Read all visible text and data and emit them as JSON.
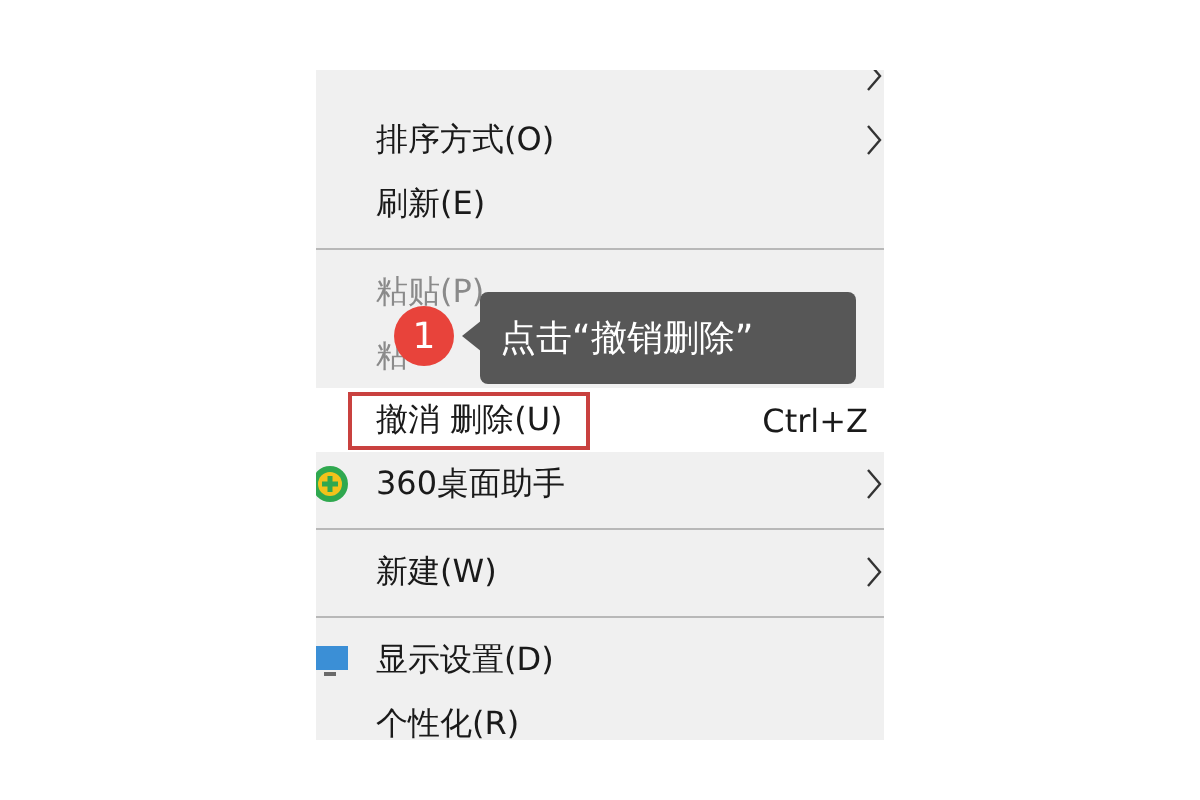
{
  "menu": {
    "items": [
      {
        "kind": "item",
        "submenu": true,
        "highlighted": false
      },
      {
        "kind": "item",
        "label": "排序方式(O)",
        "submenu": true,
        "disabled": false,
        "highlighted": false
      },
      {
        "kind": "item",
        "label": "刷新(E)",
        "submenu": false,
        "disabled": false,
        "highlighted": false
      },
      {
        "kind": "separator"
      },
      {
        "kind": "item",
        "label": "粘贴(P)",
        "submenu": false,
        "disabled": true,
        "highlighted": false
      },
      {
        "kind": "item",
        "label": "粘",
        "submenu": false,
        "disabled": true,
        "highlighted": false
      },
      {
        "kind": "item",
        "label": "撤消 删除(U)",
        "shortcut": "Ctrl+Z",
        "submenu": false,
        "disabled": false,
        "highlighted": true
      },
      {
        "kind": "item",
        "label": "360桌面助手",
        "submenu": true,
        "disabled": false,
        "highlighted": false
      },
      {
        "kind": "separator"
      },
      {
        "kind": "item",
        "label": "新建(W)",
        "submenu": true,
        "disabled": false,
        "highlighted": false
      },
      {
        "kind": "separator"
      },
      {
        "kind": "item",
        "label": "显示设置(D)",
        "submenu": false,
        "disabled": false,
        "highlighted": false
      },
      {
        "kind": "item",
        "label": "个性化(R)",
        "submenu": false,
        "disabled": false,
        "highlighted": false
      }
    ]
  },
  "callout": {
    "step": "1",
    "text": "点击“撤销删除”"
  }
}
